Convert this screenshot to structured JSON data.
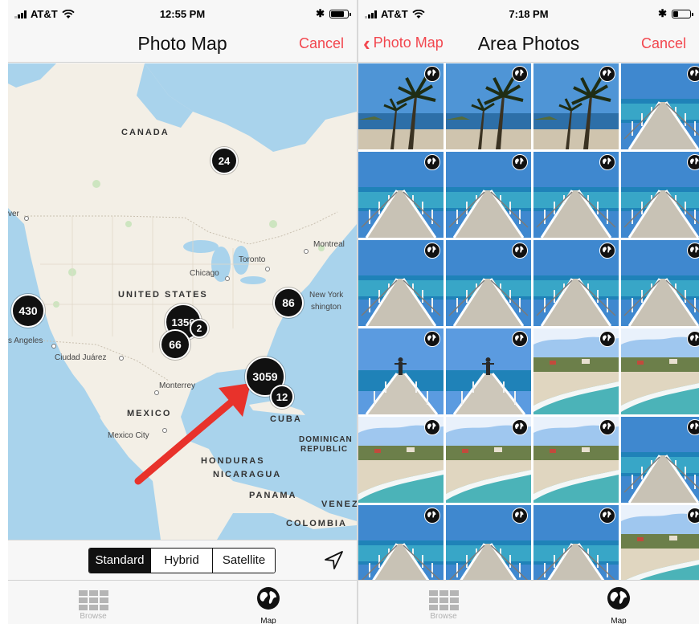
{
  "left": {
    "status": {
      "carrier": "AT&T",
      "time": "12:55 PM"
    },
    "nav": {
      "title": "Photo Map",
      "cancel": "Cancel"
    },
    "map": {
      "countries": [
        "CANADA",
        "UNITED STATES",
        "MEXICO",
        "CUBA",
        "DOMINICAN",
        "REPUBLIC",
        "HONDURAS",
        "NICARAGUA",
        "PANAMA",
        "VENEZ",
        "COLOMBIA"
      ],
      "cities": [
        "Montreal",
        "Toronto",
        "Chicago",
        "New York",
        "shington",
        "s Angeles",
        "Ciudad Juárez",
        "Monterrey",
        "Mexico City",
        "ver"
      ],
      "clusters": [
        "24",
        "430",
        "1356",
        "2",
        "66",
        "86",
        "3059",
        "12"
      ]
    },
    "segmented": {
      "standard": "Standard",
      "hybrid": "Hybrid",
      "satellite": "Satellite",
      "selected": "Standard"
    },
    "tabs": {
      "browse": "Browse",
      "map": "Map"
    }
  },
  "right": {
    "status": {
      "carrier": "AT&T",
      "time": "7:18 PM"
    },
    "nav": {
      "back": "Photo Map",
      "title": "Area Photos",
      "cancel": "Cancel"
    },
    "photos": [
      "palm",
      "palm",
      "palm",
      "pier",
      "pier",
      "pier",
      "pier",
      "pier",
      "pier",
      "pier",
      "pier",
      "pier",
      "pier-person",
      "pier-person",
      "beach",
      "beach",
      "beach",
      "beach",
      "beach",
      "pier",
      "pier",
      "pier",
      "pier",
      "beach"
    ],
    "tabs": {
      "browse": "Browse",
      "map": "Map"
    }
  },
  "colors": {
    "accent": "#f2464e",
    "water": "#a9d3ec",
    "land": "#f3efe6",
    "arrow": "#e8322b"
  }
}
